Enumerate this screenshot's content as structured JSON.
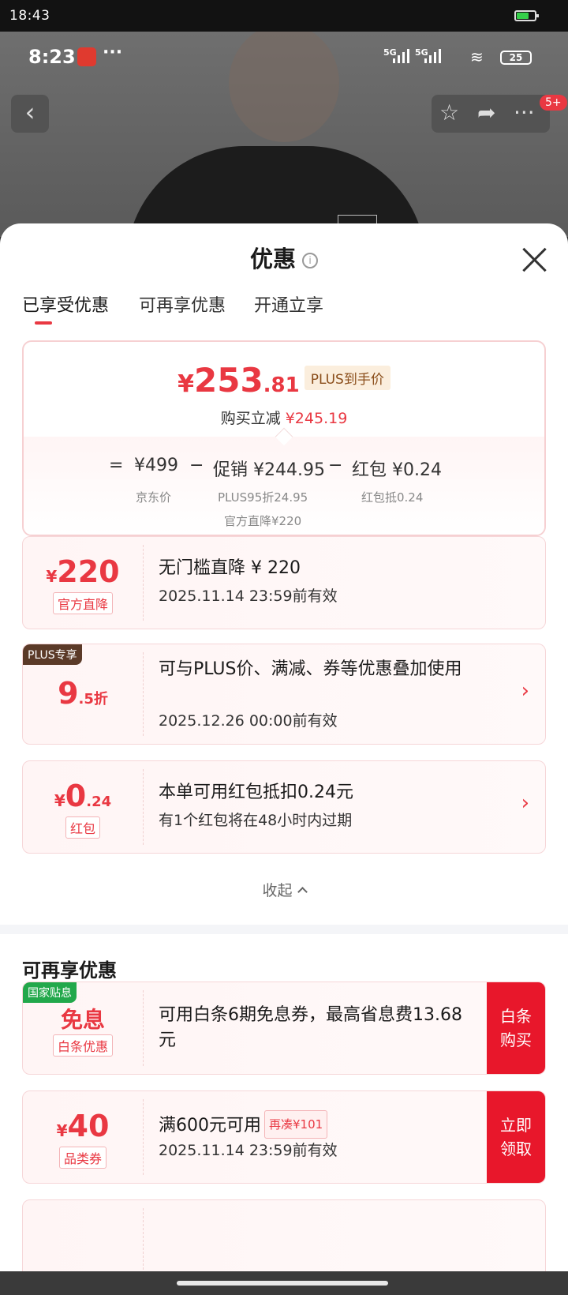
{
  "system": {
    "time": "18:43"
  },
  "phone_status": {
    "time": "8:23",
    "dots": "···",
    "net1": "5G",
    "net2": "5G",
    "battery": "25"
  },
  "nav": {
    "back": "‹",
    "badge": "5+"
  },
  "sheet": {
    "title": "优惠",
    "info_icon": "i",
    "tabs": [
      {
        "label": "已享受优惠",
        "active": true
      },
      {
        "label": "可再享优惠",
        "active": false
      },
      {
        "label": "开通立享",
        "active": false
      }
    ]
  },
  "summary": {
    "price_currency": "¥",
    "price_int": "253",
    "price_dec": ".81",
    "plus_tag": "PLUS到手价",
    "reduce_label": "购买立减",
    "reduce_value": "¥245.19",
    "calc": {
      "eq": "=",
      "base_value": "¥499",
      "base_label": "京东价",
      "minus1": "−",
      "promo_value": "促销 ¥244.95",
      "promo_sub1": "PLUS95折24.95",
      "promo_sub2": "官方直降¥220",
      "minus2": "−",
      "redpack_value": "红包 ¥0.24",
      "redpack_label": "红包抵0.24"
    }
  },
  "cards": [
    {
      "amount_sym": "¥",
      "amount_big": "220",
      "tag": "官方直降",
      "title": "无门槛直降 ¥ 220",
      "subtitle": "2025.11.14 23:59前有效"
    },
    {
      "corner": "PLUS专享",
      "amount_big": "9",
      "amount_small": ".5折",
      "title": "可与PLUS价、满减、券等优惠叠加使用",
      "subtitle": "2025.12.26 00:00前有效",
      "chevron": "›"
    },
    {
      "amount_sym": "¥",
      "amount_big": "0",
      "amount_small": ".24",
      "tag": "红包",
      "title": "本单可用红包抵扣0.24元",
      "subtitle": "有1个红包将在48小时内过期",
      "chevron": "›"
    }
  ],
  "collapse_label": "收起",
  "more_section": {
    "title": "可再享优惠",
    "cards": [
      {
        "corner": "国家贴息",
        "amount_text": "免息",
        "tag": "白条优惠",
        "title": "可用白条6期免息券，最高省息费13.68元",
        "button": [
          "白条",
          "购买"
        ]
      },
      {
        "amount_sym": "¥",
        "amount_big": "40",
        "tag": "品类券",
        "title": "满600元可用",
        "pill": "再凑¥101",
        "subtitle": "2025.11.14 23:59前有效",
        "button": [
          "立即",
          "领取"
        ]
      }
    ]
  },
  "colors": {
    "accent": "#e93842",
    "button_red": "#e8172b",
    "plus_gold": "#8a4d1a",
    "national_green": "#22a84b",
    "plus_brown": "#5b3a28"
  }
}
